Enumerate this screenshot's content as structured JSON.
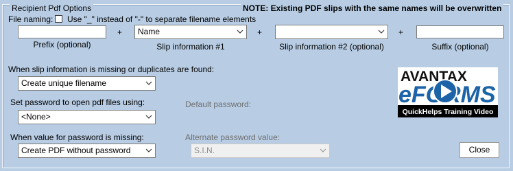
{
  "group": {
    "title": "Recipient Pdf Options",
    "note": "NOTE: Existing PDF slips with the same names will be overwritten"
  },
  "file_naming": {
    "label": "File naming:",
    "checkbox_label": "Use \"_\"  instead of \"-\" to separate filename elements",
    "checkbox_checked": false
  },
  "naming_fields": {
    "prefix_value": "",
    "prefix_caption": "Prefix (optional)",
    "plus": "+",
    "slip1_value": "Name",
    "slip1_caption": "Slip information #1",
    "slip2_value": "",
    "slip2_caption": "Slip information #2 (optional)",
    "suffix_value": "",
    "suffix_caption": "Suffix (optional)"
  },
  "missing": {
    "label": "When slip information is missing or duplicates are found:",
    "value": "Create unique filename"
  },
  "password": {
    "label": "Set password to open pdf files using:",
    "value": "<None>",
    "default_label": "Default password:",
    "default_value": ""
  },
  "missing_password": {
    "label": "When value for password is missing:",
    "value": "Create PDF without password",
    "alternate_label": "Alternate password value:",
    "alternate_value": "S.I.N."
  },
  "logo": {
    "brand_top": "AVANTAX",
    "brand_bottom": "eFORMS",
    "caption": "QuickHelps Training Video",
    "accent_color": "#1c63a8"
  },
  "close_label": "Close"
}
